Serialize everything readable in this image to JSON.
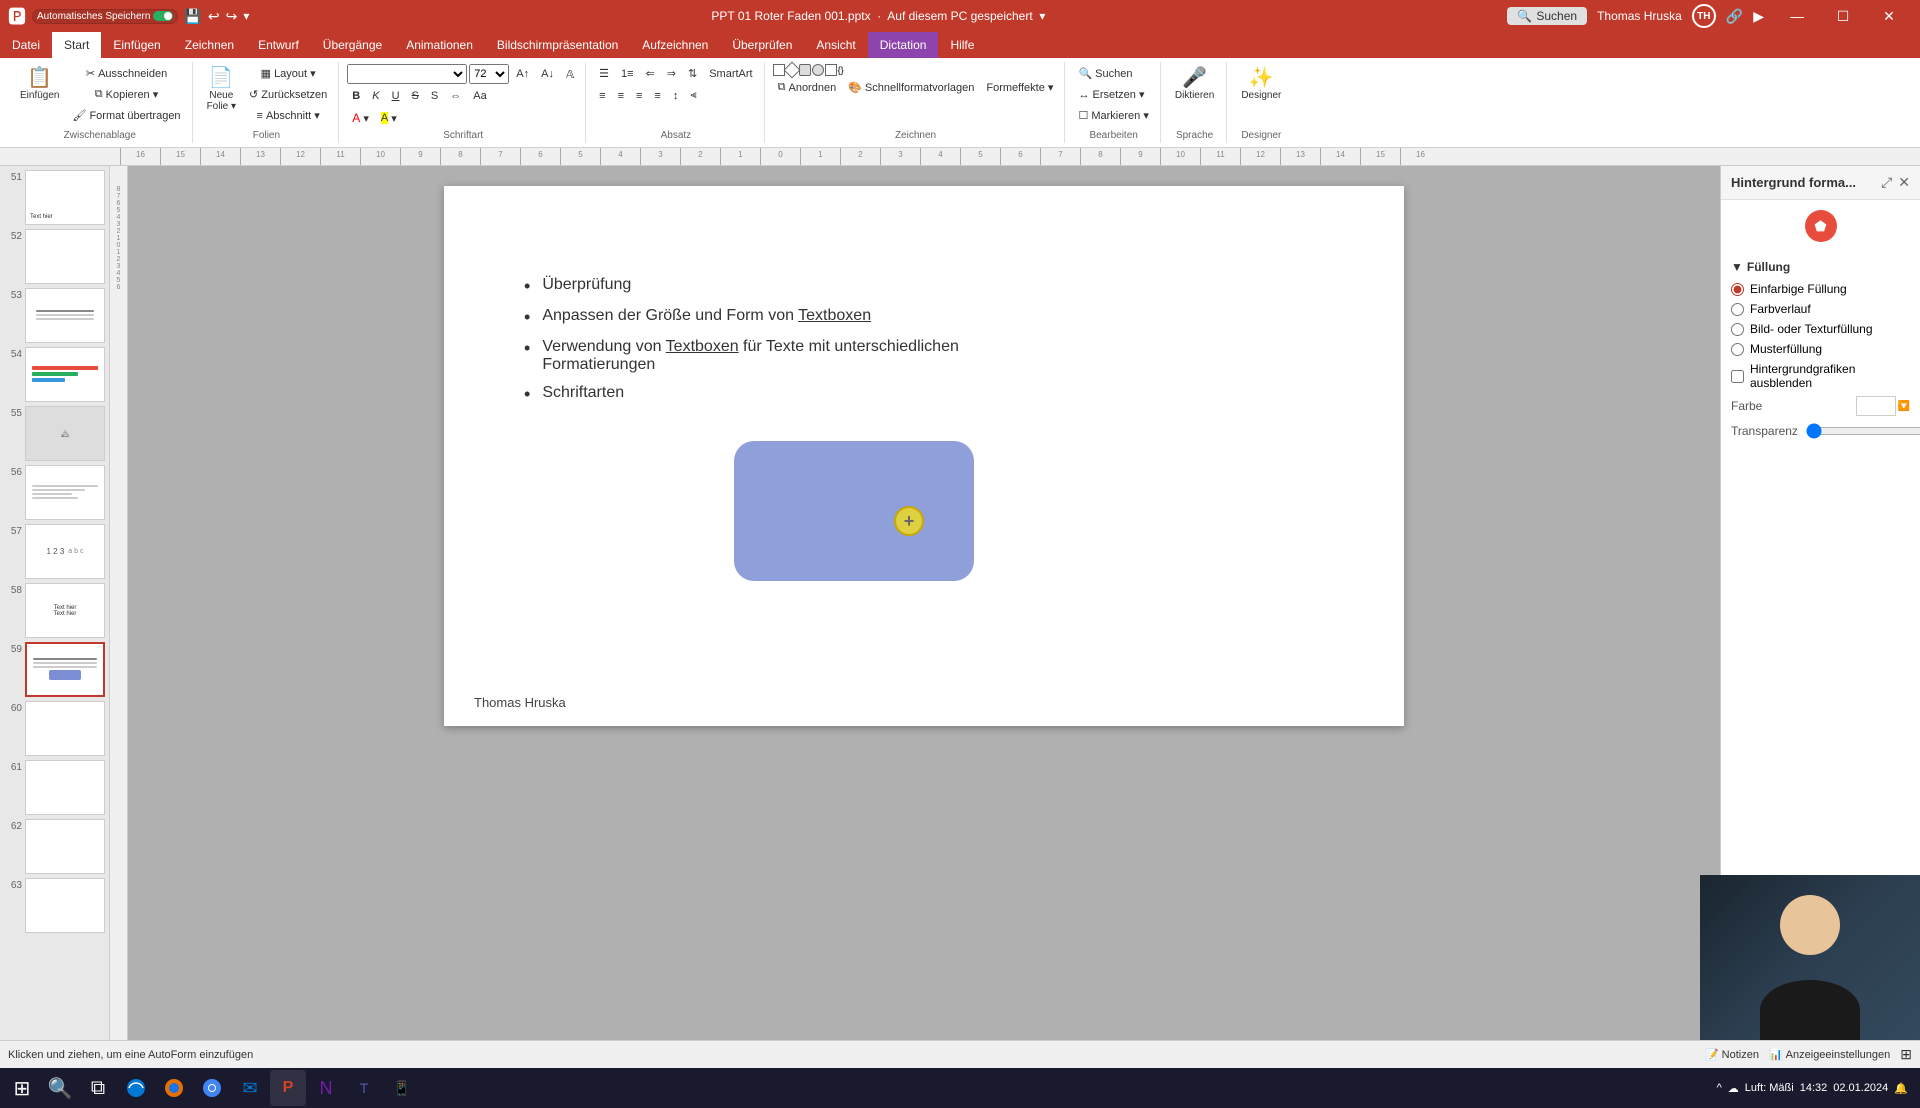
{
  "titlebar": {
    "autosave_label": "Automatisches Speichern",
    "filename": "PPT 01 Roter Faden 001.pptx",
    "save_location": "Auf diesem PC gespeichert",
    "user_name": "Thomas Hruska",
    "user_initials": "TH",
    "search_placeholder": "Suchen",
    "minimize": "—",
    "maximize": "☐",
    "close": "✕"
  },
  "tabs": {
    "items": [
      {
        "label": "Datei",
        "active": false
      },
      {
        "label": "Start",
        "active": true
      },
      {
        "label": "Einfügen",
        "active": false
      },
      {
        "label": "Zeichnen",
        "active": false
      },
      {
        "label": "Entwurf",
        "active": false
      },
      {
        "label": "Übergänge",
        "active": false
      },
      {
        "label": "Animationen",
        "active": false
      },
      {
        "label": "Bildschirmpräsentation",
        "active": false
      },
      {
        "label": "Aufzeichnen",
        "active": false
      },
      {
        "label": "Überprüfen",
        "active": false
      },
      {
        "label": "Ansicht",
        "active": false
      },
      {
        "label": "Dictation",
        "active": false
      },
      {
        "label": "Hilfe",
        "active": false
      }
    ]
  },
  "ribbon": {
    "groups": [
      {
        "label": "Zwischenablage",
        "buttons": [
          "Einfügen",
          "Ausschneiden",
          "Kopieren",
          "Format übertragen",
          "Zurücksetzen",
          "Abschnitt"
        ]
      },
      {
        "label": "Folien",
        "buttons": [
          "Neue Folie",
          "Layout",
          "Zurücksetzen",
          "Abschnitt"
        ]
      },
      {
        "label": "Schriftart",
        "buttons": [
          "B",
          "K",
          "U",
          "S"
        ]
      },
      {
        "label": "Absatz",
        "buttons": [
          "Liste",
          "Ausrichtung"
        ]
      },
      {
        "label": "Zeichnen",
        "buttons": [
          "Anordnen",
          "Schnellformatvorlagen",
          "Formeffekte"
        ]
      },
      {
        "label": "Bearbeiten",
        "buttons": [
          "Suchen",
          "Ersetzen",
          "Markieren"
        ]
      },
      {
        "label": "Sprache",
        "buttons": [
          "Diktieren"
        ]
      },
      {
        "label": "Designer",
        "buttons": [
          "Designer"
        ]
      }
    ]
  },
  "slide_panel": {
    "slides": [
      {
        "num": "51",
        "active": false
      },
      {
        "num": "52",
        "active": false
      },
      {
        "num": "53",
        "active": false
      },
      {
        "num": "54",
        "active": false
      },
      {
        "num": "55",
        "active": false
      },
      {
        "num": "56",
        "active": false
      },
      {
        "num": "57",
        "active": false
      },
      {
        "num": "58",
        "active": false
      },
      {
        "num": "59",
        "active": true
      },
      {
        "num": "60",
        "active": false
      },
      {
        "num": "61",
        "active": false
      },
      {
        "num": "62",
        "active": false
      },
      {
        "num": "63",
        "active": false
      }
    ]
  },
  "slide": {
    "bullets": [
      "Überprüfung",
      "Anpassen der Größe und Form von Textboxen",
      "Verwendung von Textboxen für Texte mit unterschiedlichen Formatierungen",
      "Schriftarten"
    ],
    "footer": "Thomas Hruska",
    "shape_color": "#7b8ed4"
  },
  "right_panel": {
    "title": "Hintergrund forma...",
    "sections": {
      "filling": {
        "label": "Füllung",
        "options": [
          {
            "label": "Einfarbige Füllung",
            "selected": true
          },
          {
            "label": "Farbverlauf",
            "selected": false
          },
          {
            "label": "Bild- oder Texturfüllung",
            "selected": false
          },
          {
            "label": "Musterfüllung",
            "selected": false
          }
        ],
        "checkbox": "Hintergrundgrafiken ausblenden",
        "color_label": "Farbe",
        "transparency_label": "Transparenz",
        "transparency_value": "0%"
      }
    }
  },
  "statusbar": {
    "left": "Klicken und ziehen, um eine AutoForm einzufügen",
    "notizen": "Notizen",
    "anzeigeeinstellungen": "Anzeigeeinstellungen"
  },
  "taskbar": {
    "items": [
      {
        "icon": "⊞",
        "name": "windows"
      },
      {
        "icon": "🔍",
        "name": "search"
      },
      {
        "icon": "📁",
        "name": "files"
      },
      {
        "icon": "🦊",
        "name": "firefox"
      },
      {
        "icon": "🌐",
        "name": "chrome"
      },
      {
        "icon": "📧",
        "name": "mail"
      },
      {
        "icon": "📊",
        "name": "powerpoint"
      },
      {
        "icon": "👤",
        "name": "people"
      }
    ],
    "tray": "Luft: Mäßi"
  }
}
